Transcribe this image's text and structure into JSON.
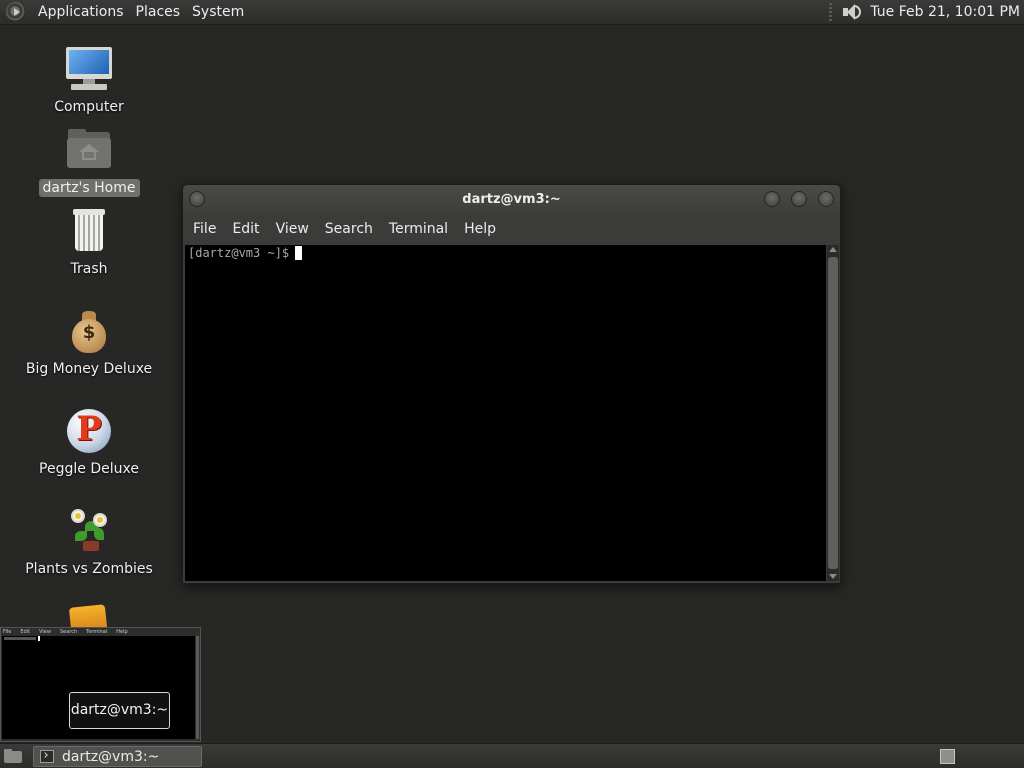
{
  "top_panel": {
    "menus": [
      "Applications",
      "Places",
      "System"
    ],
    "clock": "Tue Feb 21, 10:01 PM",
    "volume_icon": "speaker-icon"
  },
  "desktop": {
    "icons": [
      {
        "label": "Computer",
        "icon": "computer-icon"
      },
      {
        "label": "dartz's Home",
        "icon": "home-folder-icon",
        "selected": true
      },
      {
        "label": "Trash",
        "icon": "trash-icon"
      },
      {
        "label": "Big Money Deluxe",
        "icon": "money-bag-icon"
      },
      {
        "label": "Peggle Deluxe",
        "icon": "peggle-icon"
      },
      {
        "label": "Plants vs Zombies",
        "icon": "plants-icon"
      }
    ]
  },
  "terminal": {
    "title": "dartz@vm3:~",
    "menu": [
      "File",
      "Edit",
      "View",
      "Search",
      "Terminal",
      "Help"
    ],
    "prompt": "[dartz@vm3 ~]$"
  },
  "window_preview": {
    "label": "dartz@vm3:~",
    "menu": [
      "File",
      "Edit",
      "View",
      "Search",
      "Terminal",
      "Help"
    ]
  },
  "bottom_panel": {
    "task_label": "dartz@vm3:~"
  },
  "colors": {
    "desktop_bg": "#272826",
    "panel_bg": "#333432",
    "terminal_bg": "#000000",
    "selection": "#6f706c"
  }
}
